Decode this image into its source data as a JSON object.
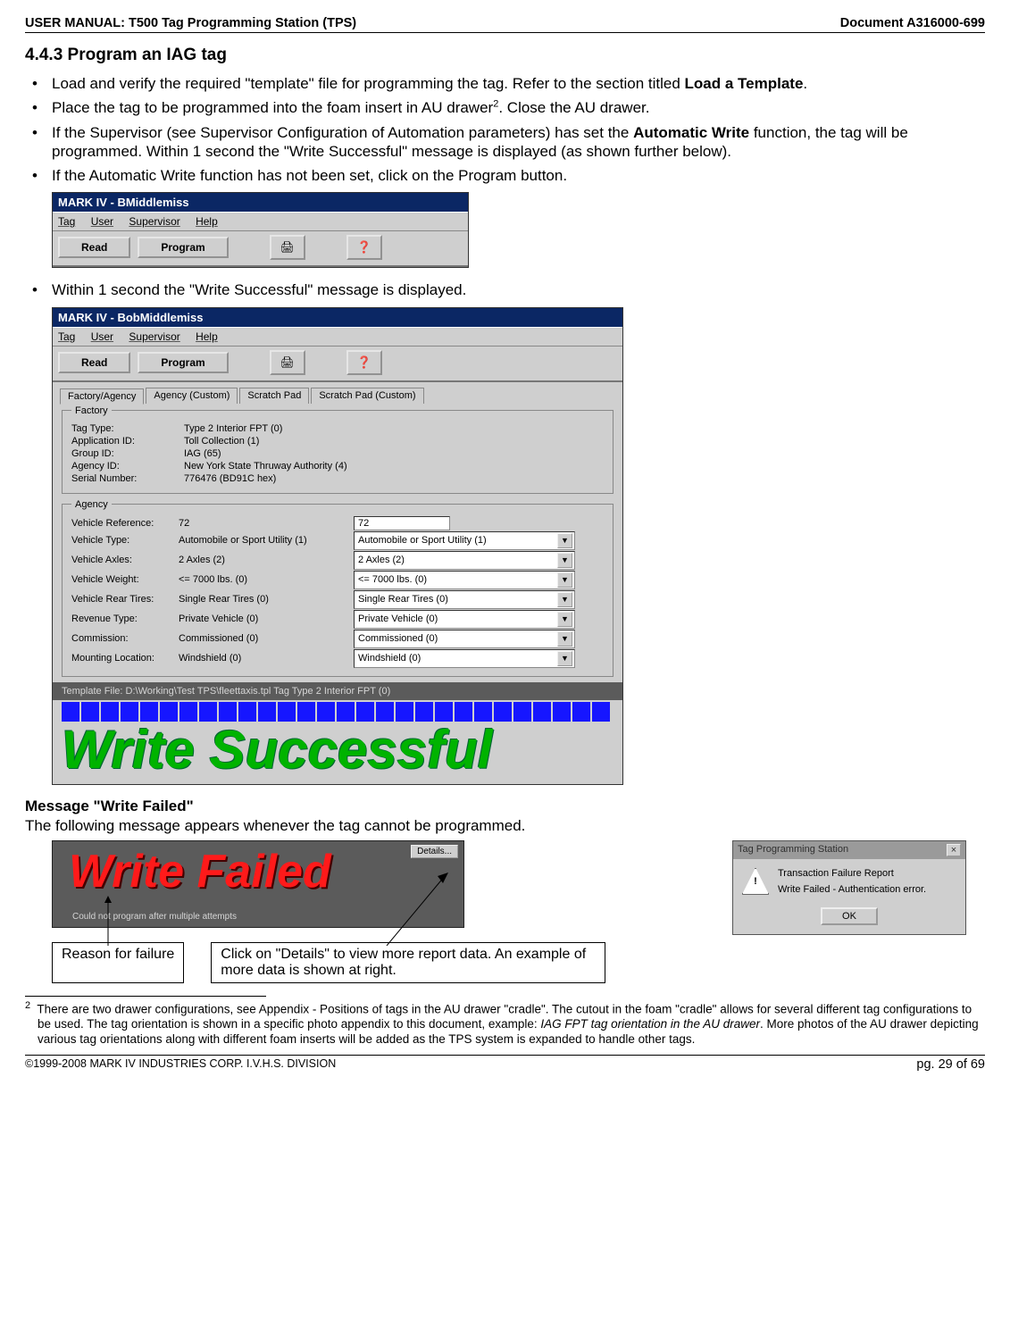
{
  "header": {
    "left": "USER MANUAL: T500 Tag Programming Station (TPS)",
    "right": "Document A316000-699"
  },
  "section_number": "4.4.3 Program an IAG tag",
  "bullets": [
    {
      "pre": "Load and verify the required \"template\" file for programming the tag. Refer to the section titled ",
      "bold": "Load a Template",
      "post": "."
    },
    {
      "pre": "Place the tag to be programmed into the foam insert in AU drawer",
      "sup": "2",
      "post": ". Close the AU drawer."
    },
    {
      "pre": "If the Supervisor (see Supervisor Configuration of Automation parameters) has set the ",
      "bold": "Automatic Write",
      "post": " function, the tag will be programmed. Within 1 second the \"Write Successful\" message is displayed (as shown further below)."
    },
    {
      "pre": "If the Automatic Write function has not been set, click on the Program button.",
      "bold": "",
      "post": ""
    }
  ],
  "tb1": {
    "title": "MARK IV - BMiddlemiss",
    "menus": [
      "Tag",
      "User",
      "Supervisor",
      "Help"
    ],
    "read": "Read",
    "program": "Program"
  },
  "bullet_after_tb1": "Within 1 second the \"Write Successful\" message is displayed.",
  "main": {
    "title": "MARK IV - BobMiddlemiss",
    "menus": [
      "Tag",
      "User",
      "Supervisor",
      "Help"
    ],
    "read": "Read",
    "program": "Program",
    "tabs": [
      "Factory/Agency",
      "Agency (Custom)",
      "Scratch Pad",
      "Scratch Pad (Custom)"
    ],
    "factory": {
      "legend": "Factory",
      "rows": [
        {
          "k": "Tag Type:",
          "v": "Type 2 Interior FPT (0)"
        },
        {
          "k": "Application ID:",
          "v": "Toll Collection (1)"
        },
        {
          "k": "Group ID:",
          "v": "IAG (65)"
        },
        {
          "k": "Agency ID:",
          "v": "New York State Thruway Authority (4)"
        },
        {
          "k": "Serial Number:",
          "v": "776476 (BD91C hex)"
        }
      ]
    },
    "agency": {
      "legend": "Agency",
      "rows": [
        {
          "k": "Vehicle Reference:",
          "v": "72",
          "c": "72",
          "text": true
        },
        {
          "k": "Vehicle Type:",
          "v": "Automobile or Sport Utility (1)",
          "c": "Automobile or Sport Utility (1)"
        },
        {
          "k": "Vehicle Axles:",
          "v": "2 Axles (2)",
          "c": "2 Axles (2)"
        },
        {
          "k": "Vehicle Weight:",
          "v": "<= 7000 lbs. (0)",
          "c": "<= 7000 lbs. (0)"
        },
        {
          "k": "Vehicle Rear Tires:",
          "v": "Single Rear Tires (0)",
          "c": "Single Rear Tires (0)"
        },
        {
          "k": "Revenue Type:",
          "v": "Private Vehicle (0)",
          "c": "Private Vehicle (0)"
        },
        {
          "k": "Commission:",
          "v": "Commissioned (0)",
          "c": "Commissioned (0)"
        },
        {
          "k": "Mounting Location:",
          "v": "Windshield (0)",
          "c": "Windshield (0)"
        }
      ]
    },
    "template_file": "Template File:   D:\\Working\\Test TPS\\fleettaxis.tpl Tag Type 2 Interior FPT (0)",
    "success_text": "Write Successful"
  },
  "fail_heading": "Message \"Write Failed\"",
  "fail_intro": "The following message appears whenever the tag cannot be programmed.",
  "failbox": {
    "details": "Details...",
    "big": "Write Failed",
    "small": "Could not program after multiple attempts"
  },
  "dlg": {
    "title": "Tag Programming Station",
    "line1": "Transaction Failure Report",
    "line2": "Write Failed - Authentication error.",
    "ok": "OK"
  },
  "callout1": "Reason for failure",
  "callout2": "Click on \"Details\" to view more report data. An example of more data is shown at right.",
  "footnote": {
    "num": "2",
    "pre": "There are two drawer configurations, see Appendix - Positions of tags in the AU drawer \"cradle\". The cutout in the foam \"cradle\" allows for several different tag configurations to be used. The tag orientation is shown in a specific photo appendix to this document, example: ",
    "em": "IAG FPT tag orientation in the AU drawer",
    "post": ". More photos of the AU drawer depicting various tag orientations along with different foam inserts will be added as the TPS system is expanded to handle other tags."
  },
  "footer": {
    "left": "©1999-2008 MARK IV INDUSTRIES CORP. I.V.H.S. DIVISION",
    "right": "pg. 29 of 69"
  }
}
